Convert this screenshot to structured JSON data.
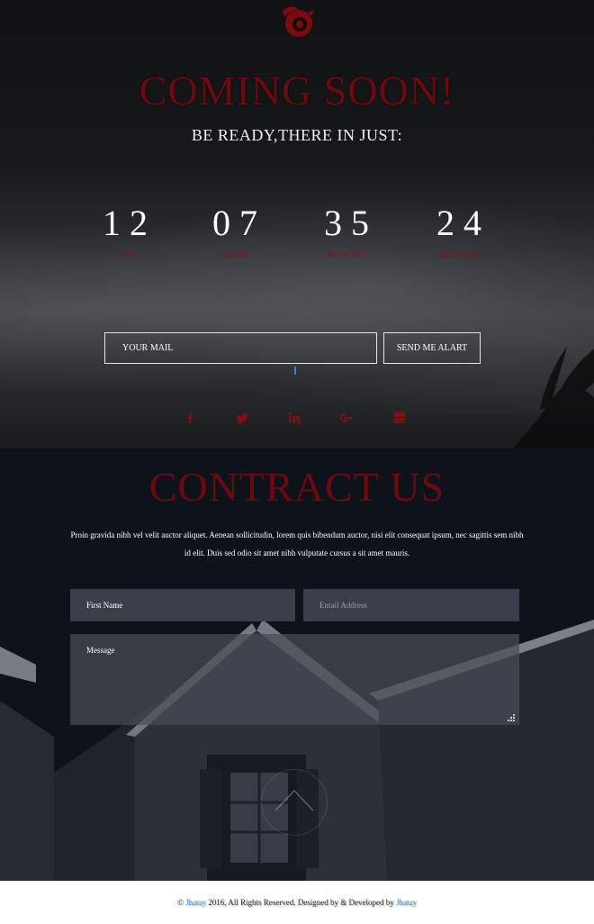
{
  "hero": {
    "logo_icon": "bird-logo-icon",
    "title": "COMING SOON!",
    "subtitle": "BE READY,THERE IN JUST:",
    "countdown": [
      {
        "value": "12",
        "label": "DAYS"
      },
      {
        "value": "07",
        "label": "HOURS"
      },
      {
        "value": "35",
        "label": "MINUTES"
      },
      {
        "value": "24",
        "label": "SECONDS"
      }
    ],
    "mail_placeholder": "YOUR MAIL",
    "alert_button": "SEND ME ALART",
    "social_icons": [
      "facebook-icon",
      "twitter-icon",
      "linkedin-icon",
      "google-plus-icon",
      "youtube-icon"
    ]
  },
  "contact": {
    "title": "CONTRACT US",
    "description": "Proin gravida nibh vel velit auctor aliquet. Aenean sollicitudin, lorem quis bibendum auctor, nisi elit consequat ipsum, nec sagittis sem nibh id elit. Duis sed odio sit amet nibh vulputate cursus a sit amet mauris.",
    "first_name_placeholder": "First Name",
    "email_placeholder": "Email Address",
    "message_placeholder": "Message"
  },
  "footer": {
    "copyright_symbol": "©",
    "brand_1": "Jhatay",
    "text_1": " 2016, All Rights Reserved. Designed by & Developed by ",
    "brand_2": "Jhatay"
  },
  "colors": {
    "accent_red": "#6d0a0c",
    "label_red": "#8a0d10",
    "contact_bg": "#0d121b",
    "field_bg": "#3a3f4b",
    "link_blue": "#4a90d9"
  }
}
